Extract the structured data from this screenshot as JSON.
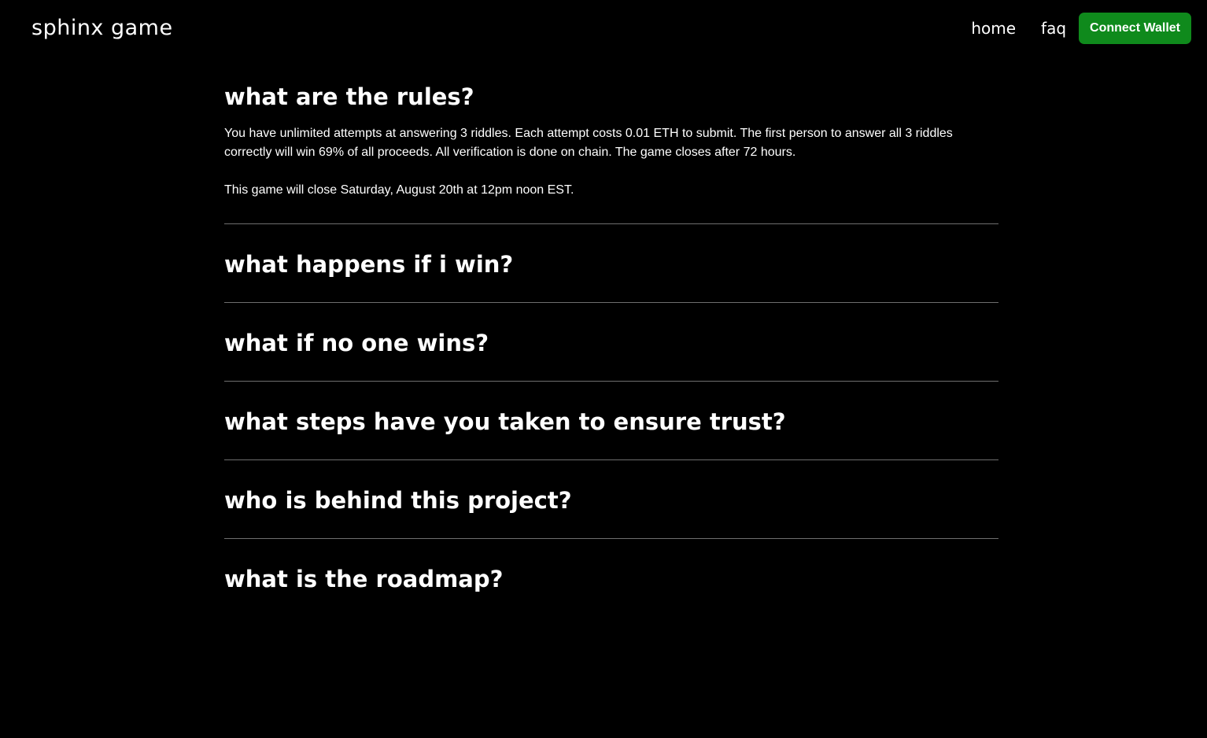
{
  "header": {
    "logo": "sphinx game",
    "nav": {
      "home": "home",
      "faq": "faq"
    },
    "connect_button": "Connect Wallet",
    "accent_color": "#0f8a1c"
  },
  "faq": {
    "items": [
      {
        "question": "what are the rules?",
        "answer": [
          "You have unlimited attempts at answering 3 riddles. Each attempt costs 0.01 ETH to submit. The first person to answer all 3 riddles correctly will win 69% of all proceeds. All verification is done on chain. The game closes after 72 hours.",
          "This game will close Saturday, August 20th at 12pm noon EST."
        ],
        "expanded": true
      },
      {
        "question": "what happens if i win?",
        "expanded": false
      },
      {
        "question": "what if no one wins?",
        "expanded": false
      },
      {
        "question": "what steps have you taken to ensure trust?",
        "expanded": false
      },
      {
        "question": "who is behind this project?",
        "expanded": false
      },
      {
        "question": "what is the roadmap?",
        "expanded": false
      }
    ]
  }
}
